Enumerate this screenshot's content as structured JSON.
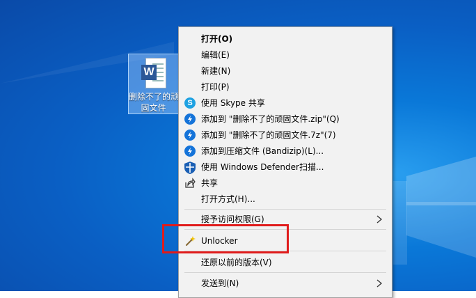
{
  "desktop": {
    "file_icon": {
      "badge": "W",
      "label_line1": "删除不了的顽固",
      "label_line2": "固文件"
    }
  },
  "context_menu": {
    "items": [
      {
        "label": "打开(O)",
        "icon": "",
        "bold": true
      },
      {
        "label": "编辑(E)",
        "icon": ""
      },
      {
        "label": "新建(N)",
        "icon": ""
      },
      {
        "label": "打印(P)",
        "icon": ""
      },
      {
        "label": "使用 Skype 共享",
        "icon": "skype-icon"
      },
      {
        "label": "添加到 \"删除不了的顽固文件.zip\"(Q)",
        "icon": "bandizip-icon"
      },
      {
        "label": "添加到 \"删除不了的顽固文件.7z\"(7)",
        "icon": "bandizip-icon"
      },
      {
        "label": "添加到压缩文件 (Bandizip)(L)...",
        "icon": "bandizip-icon"
      },
      {
        "label": "使用 Windows Defender扫描...",
        "icon": "defender-shield-icon"
      },
      {
        "label": "共享",
        "icon": "share-icon"
      },
      {
        "label": "打开方式(H)...",
        "icon": ""
      },
      {
        "label": "授予访问权限(G)",
        "icon": "",
        "submenu": true
      },
      {
        "label": "Unlocker",
        "icon": "unlocker-wand-icon"
      },
      {
        "label": "还原以前的版本(V)",
        "icon": ""
      },
      {
        "label": "发送到(N)",
        "icon": "",
        "submenu": true
      }
    ]
  },
  "annotation": {
    "color": "#e01b1b"
  },
  "colors": {
    "desktop_blue": "#0a5fc4",
    "menu_bg": "#f2f2f2"
  }
}
